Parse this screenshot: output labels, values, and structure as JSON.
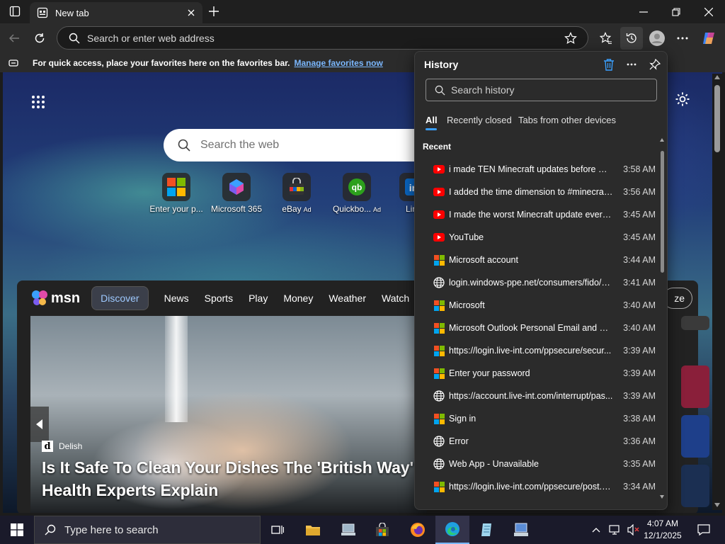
{
  "tab": {
    "title": "New tab"
  },
  "omnibox": {
    "placeholder": "Search or enter web address"
  },
  "favbar": {
    "text": "For quick access, place your favorites here on the favorites bar.",
    "link": "Manage favorites now"
  },
  "newtab": {
    "search_placeholder": "Search the web",
    "quicklinks": [
      {
        "label": "Enter your p...",
        "ad": ""
      },
      {
        "label": "Microsoft 365",
        "ad": ""
      },
      {
        "label": "eBay",
        "ad": "Ad"
      },
      {
        "label": "Quickbo...",
        "ad": "Ad"
      },
      {
        "label": "Link",
        "ad": ""
      }
    ]
  },
  "msn": {
    "logo": "msn",
    "nav": [
      "Discover",
      "News",
      "Sports",
      "Play",
      "Money",
      "Weather",
      "Watch"
    ],
    "personalize_fragment": "ze",
    "source": "Delish",
    "headline": "Is It Safe To Clean Your Dishes The 'British Way'? Health Experts Explain"
  },
  "history": {
    "title": "History",
    "search_placeholder": "Search history",
    "tabs": [
      "All",
      "Recently closed",
      "Tabs from other devices"
    ],
    "section": "Recent",
    "items": [
      {
        "title": "i made TEN Minecraft updates before Mo...",
        "time": "3:58 AM",
        "icon": "youtube"
      },
      {
        "title": "I added the time dimension to #minecraft...",
        "time": "3:56 AM",
        "icon": "youtube"
      },
      {
        "title": "I made the worst Minecraft update ever - ...",
        "time": "3:45 AM",
        "icon": "youtube"
      },
      {
        "title": "YouTube",
        "time": "3:45 AM",
        "icon": "youtube"
      },
      {
        "title": "Microsoft account",
        "time": "3:44 AM",
        "icon": "microsoft"
      },
      {
        "title": "login.windows-ppe.net/consumers/fido/c...",
        "time": "3:41 AM",
        "icon": "globe"
      },
      {
        "title": "Microsoft",
        "time": "3:40 AM",
        "icon": "microsoft"
      },
      {
        "title": "Microsoft Outlook Personal Email and Cal...",
        "time": "3:40 AM",
        "icon": "microsoft"
      },
      {
        "title": "https://login.live-int.com/ppsecure/secur...",
        "time": "3:39 AM",
        "icon": "microsoft"
      },
      {
        "title": "Enter your password",
        "time": "3:39 AM",
        "icon": "microsoft"
      },
      {
        "title": "https://account.live-int.com/interrupt/pas...",
        "time": "3:39 AM",
        "icon": "globe"
      },
      {
        "title": "Sign in",
        "time": "3:38 AM",
        "icon": "microsoft"
      },
      {
        "title": "Error",
        "time": "3:36 AM",
        "icon": "globe"
      },
      {
        "title": "Web App - Unavailable",
        "time": "3:35 AM",
        "icon": "globe"
      },
      {
        "title": "https://login.live-int.com/ppsecure/post.s...",
        "time": "3:34 AM",
        "icon": "microsoft"
      }
    ]
  },
  "taskbar": {
    "search_placeholder": "Type here to search",
    "time": "4:07 AM",
    "date": "12/1/2025"
  },
  "colors": {
    "accent": "#3aa0ff",
    "youtube": "#ff0000",
    "ms_red": "#f25022",
    "ms_green": "#7fba00",
    "ms_blue": "#00a4ef",
    "ms_yellow": "#ffb900"
  }
}
